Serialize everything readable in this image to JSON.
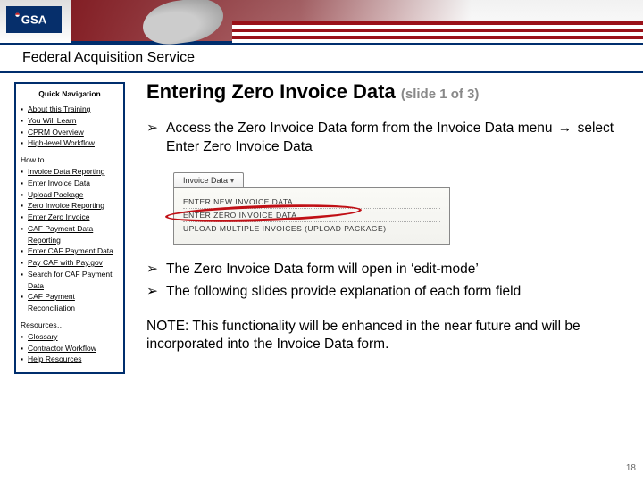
{
  "logo": "GSA",
  "header": {
    "title": "Federal Acquisition Service"
  },
  "sidebar": {
    "title": "Quick Navigation",
    "top_links": [
      "About this Training",
      "You Will Learn",
      "CPRM Overview",
      "High-level Workflow"
    ],
    "howto_label": "How to…",
    "howto_links": [
      "Invoice Data Reporting",
      "Enter Invoice Data",
      "Upload Package",
      "Zero Invoice Reporting",
      "Enter Zero Invoice",
      "CAF Payment Data Reporting",
      "Enter CAF Payment Data",
      "Pay CAF with Pay.gov",
      "Search for CAF Payment Data",
      "CAF Payment Reconciliation"
    ],
    "resources_label": "Resources…",
    "resources_links": [
      "Glossary",
      "Contractor Workflow",
      "Help Resources"
    ]
  },
  "main": {
    "title": "Entering Zero Invoice Data",
    "title_sub": "(slide 1 of 3)",
    "bullets_top": [
      "Access the Zero Invoice Data form from the Invoice Data menu → select Enter Zero Invoice Data"
    ],
    "screenshot": {
      "tab": "Invoice Data",
      "items": [
        "Enter New Invoice Data",
        "Enter Zero Invoice Data",
        "Upload Multiple Invoices (Upload Package)"
      ]
    },
    "bullets_bottom": [
      "The Zero Invoice Data form will open in ‘edit-mode’",
      "The following slides provide explanation of each form field"
    ],
    "note": "NOTE: This functionality will be enhanced in the near future and will be incorporated into the Invoice Data form."
  },
  "page_number": "18"
}
